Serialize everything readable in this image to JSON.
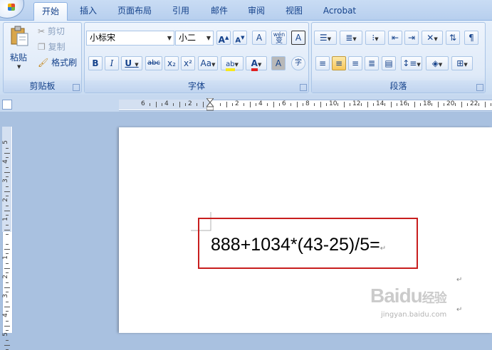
{
  "tabs": [
    {
      "label": "开始",
      "active": true
    },
    {
      "label": "插入"
    },
    {
      "label": "页面布局"
    },
    {
      "label": "引用"
    },
    {
      "label": "邮件"
    },
    {
      "label": "审阅"
    },
    {
      "label": "视图"
    },
    {
      "label": "Acrobat"
    }
  ],
  "clipboard": {
    "title": "剪贴板",
    "paste": "粘贴",
    "cut": "剪切",
    "copy": "复制",
    "format_painter": "格式刷"
  },
  "font": {
    "title": "字体",
    "font_name": "小标宋",
    "font_size": "小二",
    "grow": "A",
    "shrink": "A",
    "clear": "A",
    "phonetic": "wén",
    "phonetic_char": "变",
    "border_char": "A",
    "bold": "B",
    "italic": "I",
    "underline": "U",
    "strike": "abc",
    "subscript": "x₂",
    "superscript": "x²",
    "case": "Aa",
    "highlight": "ab",
    "font_color": "A",
    "shading": "A",
    "enclose": "字"
  },
  "paragraph": {
    "title": "段落"
  },
  "ruler": {
    "h_ticks": [
      "6",
      "4",
      "2",
      "",
      "2",
      "4",
      "6",
      "8",
      "10",
      "12",
      "14",
      "16",
      "18",
      "20",
      "22"
    ],
    "v_ticks": [
      "5",
      "4",
      "3",
      "2",
      "1",
      "",
      "1",
      "2",
      "3",
      "4",
      "5"
    ]
  },
  "document": {
    "formula": "888+1034*(43-25)/5=",
    "para_mark": "↵"
  },
  "watermark": {
    "brand": "Baidu",
    "sub": "jingyan.baidu.com",
    "cn": "经验"
  },
  "colors": {
    "highlight": "#f7e81b",
    "font_color": "#e02020",
    "box_border": "#c81e1e"
  }
}
